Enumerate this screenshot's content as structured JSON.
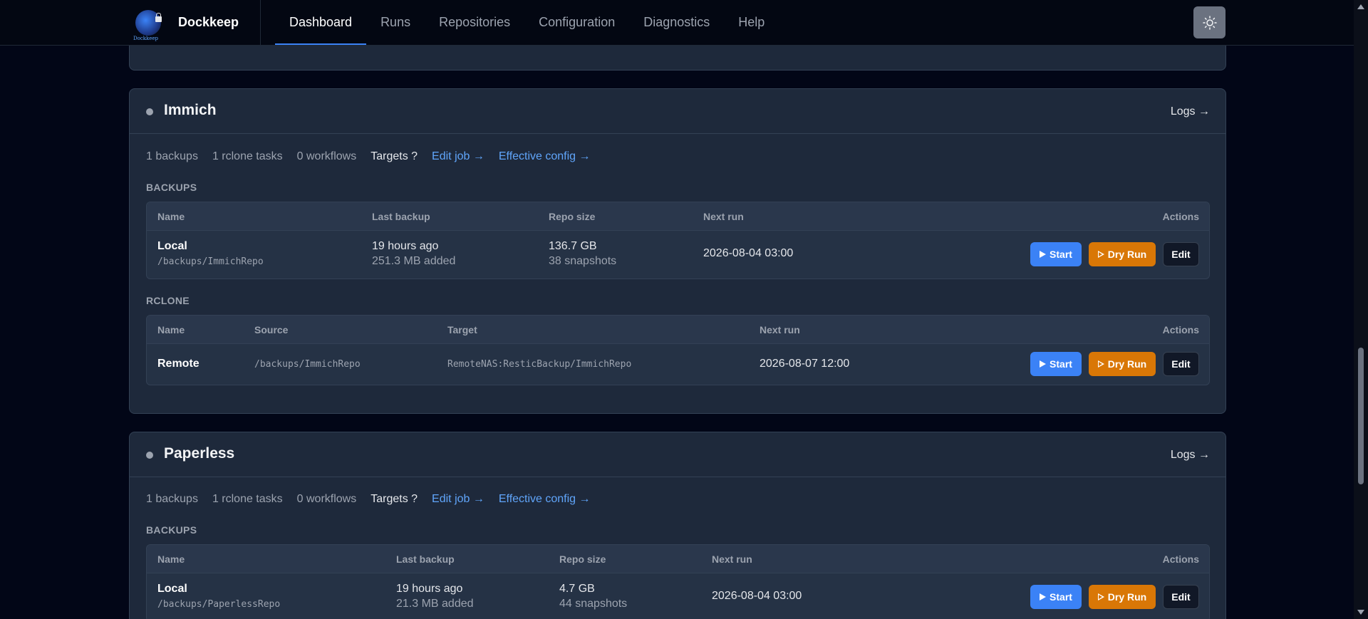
{
  "app": {
    "name": "Dockkeep",
    "logo_text": "Dockkeep"
  },
  "nav": {
    "items": [
      "Dashboard",
      "Runs",
      "Repositories",
      "Configuration",
      "Diagnostics",
      "Help"
    ],
    "active": "Dashboard"
  },
  "icons": {
    "theme_toggle": "sun-icon",
    "play": "play-icon",
    "dry_run": "play-outline-icon"
  },
  "colors": {
    "accent": "#3b82f6",
    "dry_run": "#d97706",
    "link": "#60a5fa",
    "status_idle": "#9ca3af"
  },
  "jobs": [
    {
      "title": "Immich",
      "logs_label": "Logs →",
      "summary": {
        "backups": "1 backups",
        "rclone": "1 rclone tasks",
        "workflows": "0 workflows",
        "targets": "Targets ?",
        "edit_job": "Edit job →",
        "effective_config": "Effective config →"
      },
      "backups_label": "BACKUPS",
      "backup_columns": [
        "Name",
        "Last backup",
        "Repo size",
        "Next run",
        "Actions"
      ],
      "backups": [
        {
          "name": "Local",
          "path": "/backups/ImmichRepo",
          "last_backup": "19 hours ago",
          "added": "251.3 MB added",
          "repo_size": "136.7 GB",
          "snapshots": "38 snapshots",
          "next_run": "2026-08-04 03:00"
        }
      ],
      "rclone_label": "RCLONE",
      "rclone_columns": [
        "Name",
        "Source",
        "Target",
        "Next run",
        "Actions"
      ],
      "rclone": [
        {
          "name": "Remote",
          "source": "/backups/ImmichRepo",
          "target": "RemoteNAS:ResticBackup/ImmichRepo",
          "next_run": "2026-08-07 12:00"
        }
      ]
    },
    {
      "title": "Paperless",
      "logs_label": "Logs →",
      "summary": {
        "backups": "1 backups",
        "rclone": "1 rclone tasks",
        "workflows": "0 workflows",
        "targets": "Targets ?",
        "edit_job": "Edit job →",
        "effective_config": "Effective config →"
      },
      "backups_label": "BACKUPS",
      "backup_columns": [
        "Name",
        "Last backup",
        "Repo size",
        "Next run",
        "Actions"
      ],
      "backups": [
        {
          "name": "Local",
          "path": "/backups/PaperlessRepo",
          "last_backup": "19 hours ago",
          "added": "21.3 MB added",
          "repo_size": "4.7 GB",
          "snapshots": "44 snapshots",
          "next_run": "2026-08-04 03:00"
        }
      ]
    }
  ],
  "buttons": {
    "start": "Start",
    "dry_run": "Dry Run",
    "edit": "Edit"
  }
}
